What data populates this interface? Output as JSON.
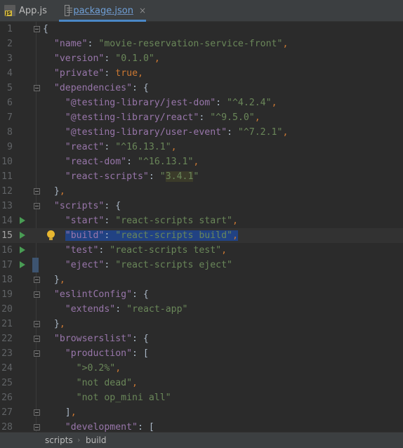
{
  "tabs": [
    {
      "label": "App.js",
      "icon": "js-file-icon",
      "active": false
    },
    {
      "label": "package.json",
      "icon": "json-file-icon",
      "active": true,
      "close": "×"
    }
  ],
  "editor": {
    "lines": [
      {
        "num": "1"
      },
      {
        "num": "2"
      },
      {
        "num": "3"
      },
      {
        "num": "4"
      },
      {
        "num": "5"
      },
      {
        "num": "6"
      },
      {
        "num": "7"
      },
      {
        "num": "8"
      },
      {
        "num": "9"
      },
      {
        "num": "10"
      },
      {
        "num": "11"
      },
      {
        "num": "12"
      },
      {
        "num": "13"
      },
      {
        "num": "14"
      },
      {
        "num": "15"
      },
      {
        "num": "16"
      },
      {
        "num": "17"
      },
      {
        "num": "18"
      },
      {
        "num": "19"
      },
      {
        "num": "20"
      },
      {
        "num": "21"
      },
      {
        "num": "22"
      },
      {
        "num": "23"
      },
      {
        "num": "24"
      },
      {
        "num": "25"
      },
      {
        "num": "26"
      },
      {
        "num": "27"
      },
      {
        "num": "28"
      }
    ],
    "text": {
      "name_key": "\"name\"",
      "name_val": "\"movie-reservation-service-front\"",
      "version_key": "\"version\"",
      "version_val": "\"0.1.0\"",
      "private_key": "\"private\"",
      "private_val": "true",
      "dependencies_key": "\"dependencies\"",
      "dep1_key": "\"@testing-library/jest-dom\"",
      "dep1_val": "\"^4.2.4\"",
      "dep2_key": "\"@testing-library/react\"",
      "dep2_val": "\"^9.5.0\"",
      "dep3_key": "\"@testing-library/user-event\"",
      "dep3_val": "\"^7.2.1\"",
      "dep4_key": "\"react\"",
      "dep4_val": "\"^16.13.1\"",
      "dep5_key": "\"react-dom\"",
      "dep5_val": "\"^16.13.1\"",
      "dep6_key": "\"react-scripts\"",
      "dep6_val_pre": "\"",
      "dep6_val_mid": "3.4.1",
      "dep6_val_post": "\"",
      "scripts_key": "\"scripts\"",
      "start_key": "\"start\"",
      "start_val": "\"react-scripts start\"",
      "build_key": "\"build\"",
      "build_val": "\"react-scripts build\"",
      "test_key": "\"test\"",
      "test_val": "\"react-scripts test\"",
      "eject_key": "\"eject\"",
      "eject_val": "\"react-scripts eject\"",
      "eslint_key": "\"eslintConfig\"",
      "extends_key": "\"extends\"",
      "extends_val": "\"react-app\"",
      "browserslist_key": "\"browserslist\"",
      "production_key": "\"production\"",
      "prod1": "\">0.2%\"",
      "prod2": "\"not dead\"",
      "prod3": "\"not op_mini all\"",
      "development_key": "\"development\""
    }
  },
  "breadcrumb": {
    "items": [
      "scripts",
      "build"
    ],
    "separator": "›"
  },
  "colors": {
    "background": "#2b2b2b",
    "key": "#9876aa",
    "string": "#6a8759",
    "punct": "#cc7832",
    "selection": "#214283"
  }
}
